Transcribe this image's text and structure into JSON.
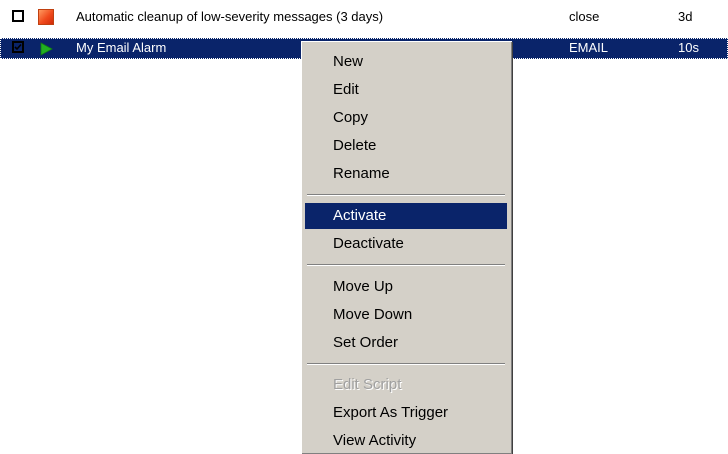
{
  "list": {
    "rows": [
      {
        "checked": false,
        "status_icon": "red-square-icon",
        "name": "Automatic cleanup of low-severity messages (3 days)",
        "action": "close",
        "interval": "3d",
        "selected": false
      },
      {
        "checked": true,
        "status_icon": "green-play-icon",
        "name": "My Email Alarm",
        "action": "EMAIL",
        "interval": "10s",
        "selected": true
      }
    ]
  },
  "context_menu": {
    "items": [
      {
        "label": "New"
      },
      {
        "label": "Edit"
      },
      {
        "label": "Copy"
      },
      {
        "label": "Delete"
      },
      {
        "label": "Rename"
      },
      {
        "label": "Activate",
        "highlighted": true
      },
      {
        "label": "Deactivate"
      },
      {
        "label": "Move Up"
      },
      {
        "label": "Move Down"
      },
      {
        "label": "Set Order"
      },
      {
        "label": "Edit Script",
        "disabled": true
      },
      {
        "label": "Export As Trigger"
      },
      {
        "label": "View Activity"
      }
    ]
  },
  "colors": {
    "selection": "#0a246a",
    "menu_background": "#d4d0c8",
    "disabled_text": "#a0a0a0",
    "status_red": "#f04a1c",
    "status_green": "#22b022"
  }
}
